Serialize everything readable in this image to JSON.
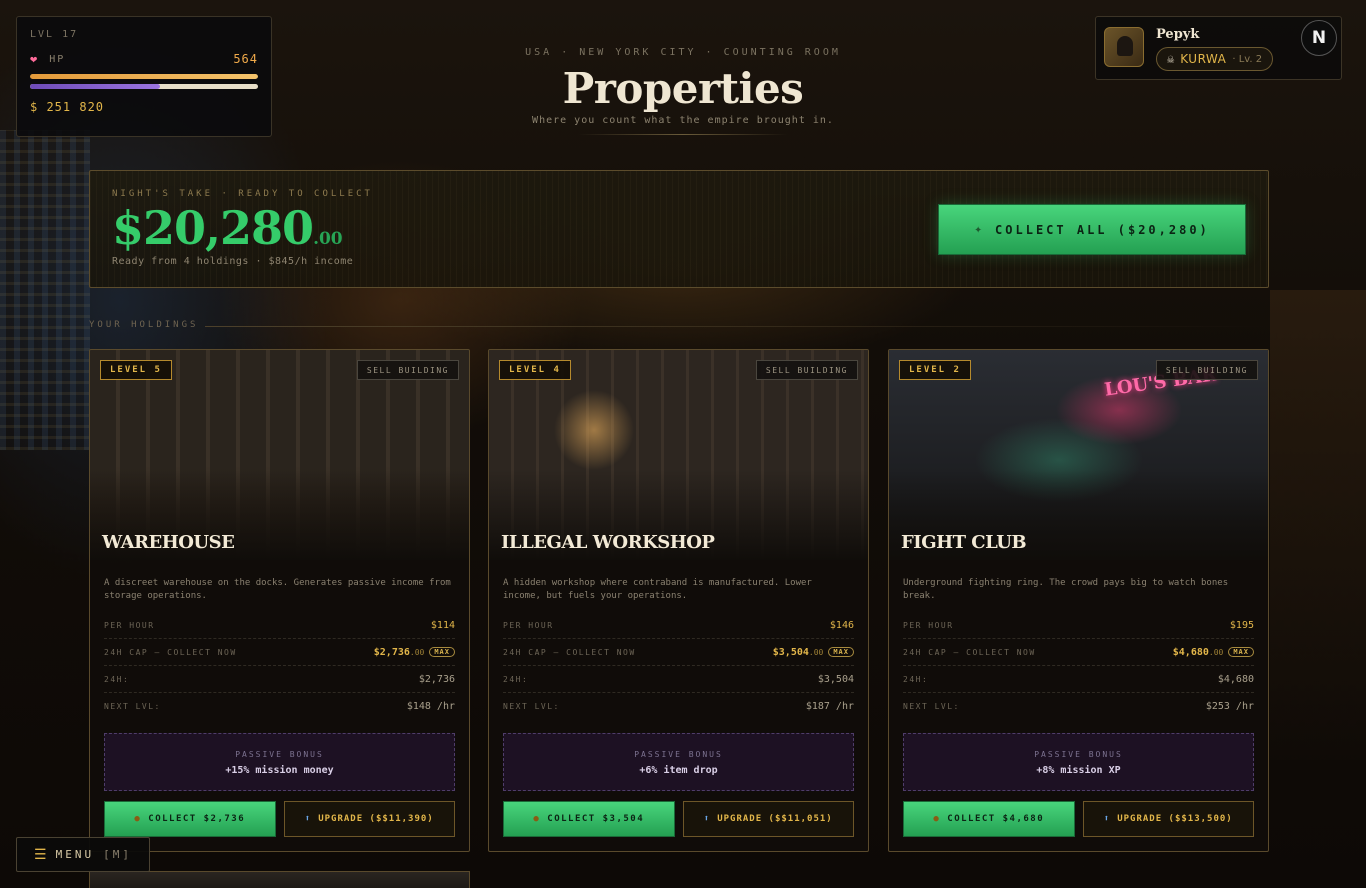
{
  "stats": {
    "level": "LVL 17",
    "hp_label": "HP",
    "hp_value": "564",
    "hp_fraction": 1.0,
    "xp_fraction": 0.57,
    "money": "$ 251 820"
  },
  "header": {
    "breadcrumb": "USA · NEW YORK CITY · COUNTING ROOM",
    "title": "Properties",
    "subtitle": "Where you count what the empire brought in."
  },
  "player": {
    "name": "Pepyk",
    "gang": "KURWA",
    "gang_level": "· Lv. 2",
    "notif_badge": "N"
  },
  "night_take": {
    "label": "NIGHT'S TAKE · READY TO COLLECT",
    "amount": "$20,280",
    "cents": ".00",
    "subtext": "Ready from 4 holdings · $845/h income",
    "collect_all_label": "COLLECT ALL ($20,280)",
    "collect_icon": "money-icon"
  },
  "holdings_label": "YOUR HOLDINGS",
  "cards": [
    {
      "level": "LEVEL 5",
      "sell": "SELL BUILDING",
      "name": "WAREHOUSE",
      "desc": "A discreet warehouse on the docks. Generates passive income from storage operations.",
      "per_hour_label": "PER HOUR",
      "per_hour": "$114",
      "cap_label": "24H CAP — COLLECT NOW",
      "cap_value": "$2,736",
      "cap_cents": ".00",
      "max": "MAX",
      "day_label": "24H:",
      "day_value": "$2,736",
      "next_label": "NEXT LVL:",
      "next_value": "$148 /hr",
      "bonus_label": "PASSIVE BONUS",
      "bonus_value": "+15% mission money",
      "collect": "COLLECT $2,736",
      "upgrade": "UPGRADE ($$11,390)"
    },
    {
      "level": "LEVEL 4",
      "sell": "SELL BUILDING",
      "name": "ILLEGAL WORKSHOP",
      "desc": "A hidden workshop where contraband is manufactured. Lower income, but fuels your operations.",
      "per_hour_label": "PER HOUR",
      "per_hour": "$146",
      "cap_label": "24H CAP — COLLECT NOW",
      "cap_value": "$3,504",
      "cap_cents": ".00",
      "max": "MAX",
      "day_label": "24H:",
      "day_value": "$3,504",
      "next_label": "NEXT LVL:",
      "next_value": "$187 /hr",
      "bonus_label": "PASSIVE BONUS",
      "bonus_value": "+6% item drop",
      "collect": "COLLECT $3,504",
      "upgrade": "UPGRADE ($$11,051)"
    },
    {
      "level": "LEVEL 2",
      "sell": "SELL BUILDING",
      "name": "FIGHT CLUB",
      "sign": "LOU'S BAR",
      "desc": "Underground fighting ring. The crowd pays big to watch bones break.",
      "per_hour_label": "PER HOUR",
      "per_hour": "$195",
      "cap_label": "24H CAP — COLLECT NOW",
      "cap_value": "$4,680",
      "cap_cents": ".00",
      "max": "MAX",
      "day_label": "24H:",
      "day_value": "$4,680",
      "next_label": "NEXT LVL:",
      "next_value": "$253 /hr",
      "bonus_label": "PASSIVE BONUS",
      "bonus_value": "+8% mission XP",
      "collect": "COLLECT $4,680",
      "upgrade": "UPGRADE ($$13,500)"
    }
  ],
  "menu": {
    "label": "MENU",
    "shortcut": "[M]"
  }
}
